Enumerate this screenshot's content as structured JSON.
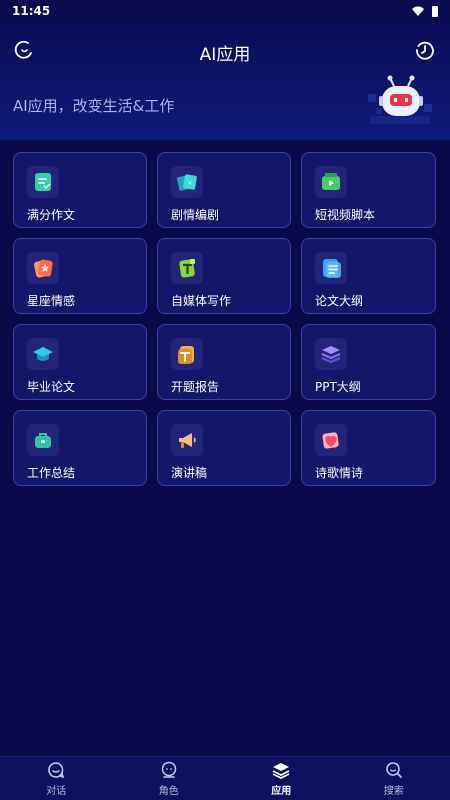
{
  "status_bar": {
    "time": "11:45"
  },
  "header": {
    "title": "AI应用",
    "banner_text": "AI应用，改变生活&工作"
  },
  "apps": [
    {
      "label": "满分作文",
      "icon": "essay-icon",
      "color": "#2dd4a8"
    },
    {
      "label": "剧情编剧",
      "icon": "script-cards-icon",
      "color": "#28c9c9"
    },
    {
      "label": "短视频脚本",
      "icon": "video-icon",
      "color": "#3fcf6a"
    },
    {
      "label": "星座情感",
      "icon": "horoscope-icon",
      "color": "#ff7a59"
    },
    {
      "label": "自媒体写作",
      "icon": "media-writing-icon",
      "color": "#8bd43a"
    },
    {
      "label": "论文大纲",
      "icon": "outline-icon",
      "color": "#3aa0ff"
    },
    {
      "label": "毕业论文",
      "icon": "graduation-cap-icon",
      "color": "#36c6e8"
    },
    {
      "label": "开题报告",
      "icon": "report-icon",
      "color": "#f0b23a"
    },
    {
      "label": "PPT大纲",
      "icon": "layers-icon",
      "color": "#8a6cf0"
    },
    {
      "label": "工作总结",
      "icon": "briefcase-icon",
      "color": "#2ec4a6"
    },
    {
      "label": "演讲稿",
      "icon": "megaphone-icon",
      "color": "#f2c07a"
    },
    {
      "label": "诗歌情诗",
      "icon": "heart-icon",
      "color": "#ff5a6a"
    }
  ],
  "tabbar": {
    "tabs": [
      {
        "label": "对话"
      },
      {
        "label": "角色"
      },
      {
        "label": "应用"
      },
      {
        "label": "搜索"
      }
    ],
    "active_index": 2
  }
}
